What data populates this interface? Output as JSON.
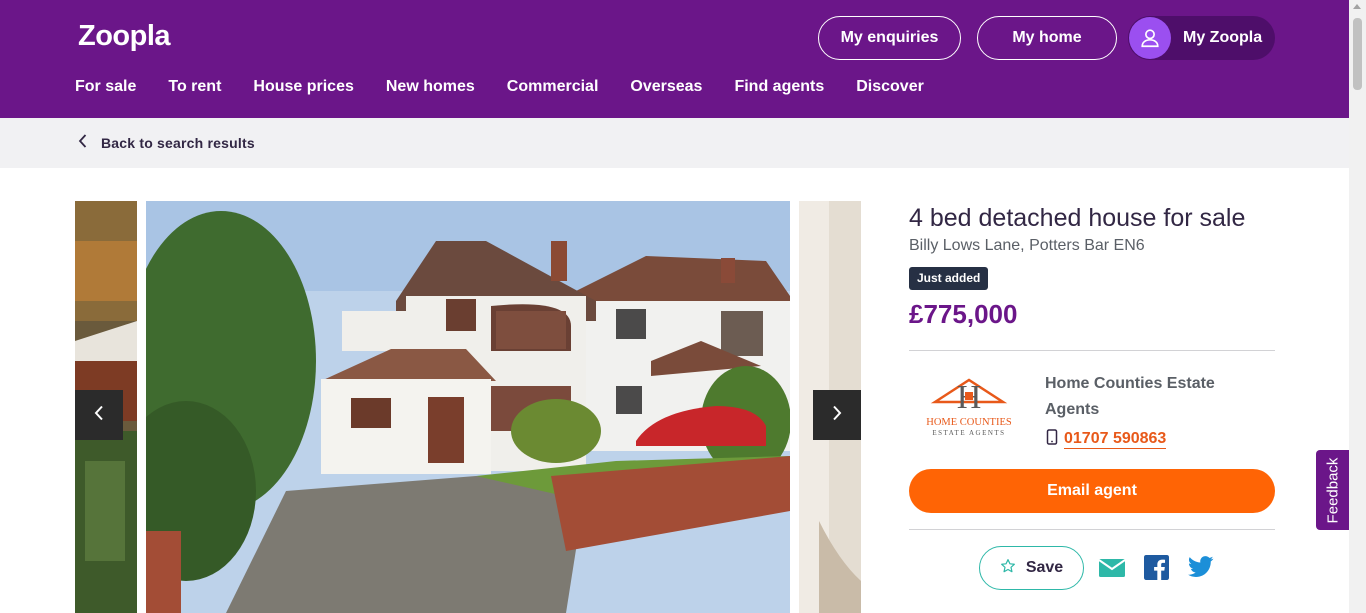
{
  "header": {
    "logo": "Zoopla",
    "buttons": {
      "enquiries": "My enquiries",
      "home": "My home",
      "my_zoopla": "My Zoopla"
    },
    "nav": [
      "For sale",
      "To rent",
      "House prices",
      "New homes",
      "Commercial",
      "Overseas",
      "Find agents",
      "Discover"
    ]
  },
  "breadcrumb": {
    "back_label": "Back to search results"
  },
  "listing": {
    "title": "4 bed detached house for sale",
    "address": "Billy Lows Lane, Potters Bar EN6",
    "badge": "Just added",
    "price": "£775,000"
  },
  "agent": {
    "name": "Home Counties Estate Agents",
    "logo_line1": "HOME COUNTIES",
    "logo_line2": "ESTATE AGENTS",
    "phone": "01707 590863"
  },
  "actions": {
    "email_label": "Email agent",
    "save_label": "Save"
  },
  "icons": {
    "back": "chevron-left-icon",
    "user": "user-icon",
    "prev": "chevron-left-icon",
    "next": "chevron-right-icon",
    "phone": "mobile-phone-icon",
    "save": "star-icon",
    "mail": "mail-icon",
    "facebook": "facebook-icon",
    "twitter": "twitter-icon"
  },
  "feedback": {
    "label": "Feedback"
  },
  "colors": {
    "brand_purple": "#6b1689",
    "accent_orange": "#ff6405",
    "teal": "#2eb8a8",
    "badge": "#263044"
  }
}
